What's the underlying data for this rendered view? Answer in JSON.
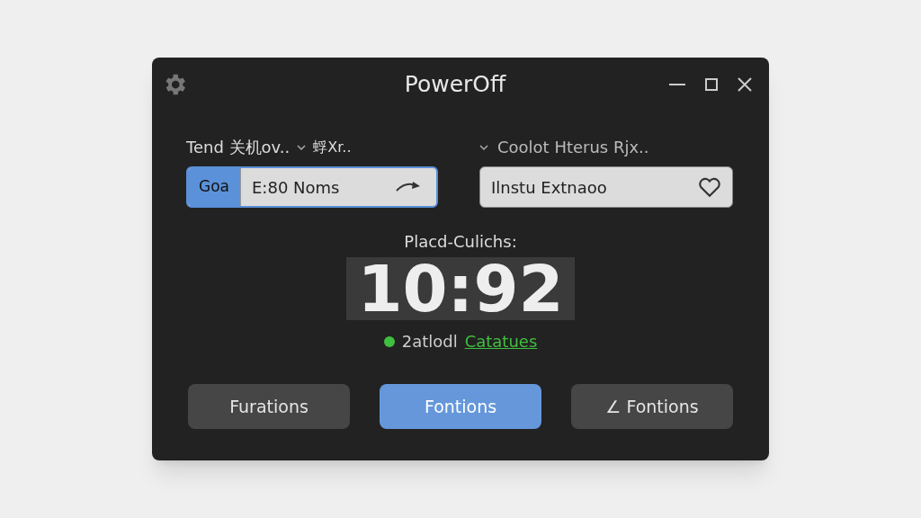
{
  "window": {
    "title": "PowerOff"
  },
  "left": {
    "label": "Tend 关机ov..",
    "extra": "蜉Xr..",
    "segment": "Goa",
    "value": "E:80 Noms"
  },
  "right": {
    "label": "Coolot Hterus Rjx..",
    "value": "Ilnstu Extnaoo"
  },
  "clock": {
    "label": "Placd-Culichs:",
    "time": "10:92",
    "status": "2atlodl",
    "link": "Catatues",
    "color": "#3fbf3f"
  },
  "buttons": [
    {
      "label": "Furations",
      "selected": false
    },
    {
      "label": "Fontions",
      "selected": true
    },
    {
      "label": "∠ Fontions",
      "selected": false
    }
  ]
}
